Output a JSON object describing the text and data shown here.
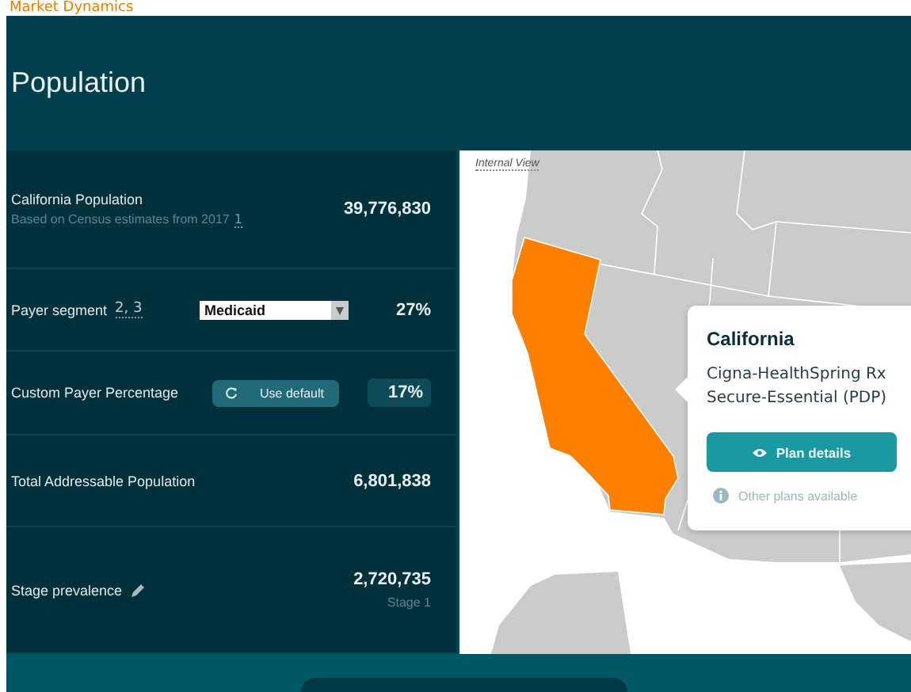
{
  "breadcrumb": "Market Dynamics",
  "title": "Population",
  "rows": [
    {
      "kind": "stat",
      "label": "California Population",
      "note": "Based on Census estimates from 2017",
      "ref": "1",
      "value": "39,776,830"
    },
    {
      "kind": "select",
      "label": "Payer segment",
      "ref": "2, 3",
      "option": "Medicaid",
      "value": "27%"
    },
    {
      "kind": "custom",
      "label": "Custom Payer Percentage",
      "button": "Use default",
      "value": "17%"
    },
    {
      "kind": "stat",
      "label": "Total Addressable Population",
      "value": "6,801,838"
    },
    {
      "kind": "edit",
      "label": "Stage prevalence",
      "value": "2,720,735",
      "sub": "Stage 1"
    }
  ],
  "map": {
    "badge": "Internal View",
    "popup": {
      "state": "California",
      "plan": "Cigna-HealthSpring Rx Secure-Essential (PDP)",
      "button": "Plan details",
      "link": "Other plans available"
    }
  }
}
